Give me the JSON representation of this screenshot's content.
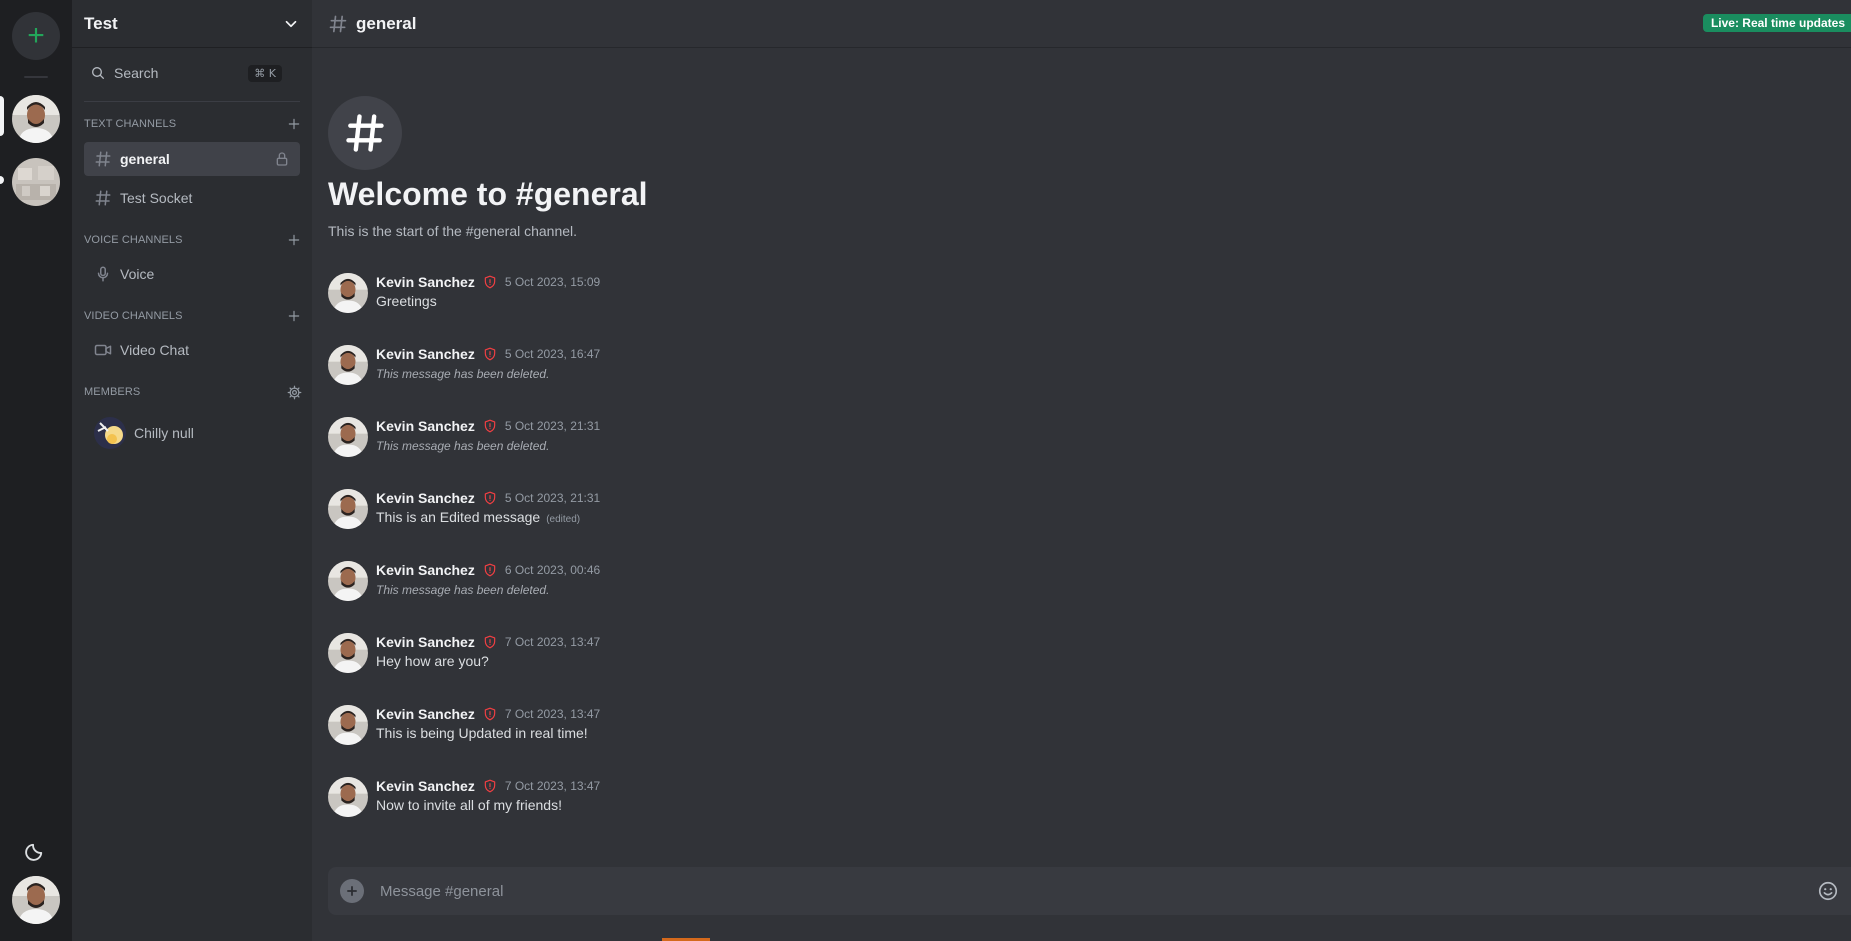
{
  "server_rail": {
    "add_symbol": "+"
  },
  "sidebar": {
    "server_name": "Test",
    "search_label": "Search",
    "search_shortcut": "⌘ K",
    "sections": {
      "text": "TEXT CHANNELS",
      "voice": "VOICE CHANNELS",
      "video": "VIDEO CHANNELS",
      "members": "MEMBERS"
    },
    "text_channels": [
      {
        "label": "general",
        "active": true,
        "locked": true
      },
      {
        "label": "Test Socket",
        "active": false
      }
    ],
    "voice_channels": [
      {
        "label": "Voice"
      }
    ],
    "video_channels": [
      {
        "label": "Video Chat"
      }
    ],
    "members": [
      {
        "label": "Chilly null"
      }
    ]
  },
  "header": {
    "channel_name": "general",
    "live_badge": "Live: Real time updates"
  },
  "welcome": {
    "title": "Welcome to #general",
    "subtitle": "This is the start of the #general channel."
  },
  "messages": [
    {
      "author": "Kevin Sanchez",
      "time": "5 Oct 2023, 15:09",
      "text": "Greetings",
      "deleted": false
    },
    {
      "author": "Kevin Sanchez",
      "time": "5 Oct 2023, 16:47",
      "text": "This message has been deleted.",
      "deleted": true
    },
    {
      "author": "Kevin Sanchez",
      "time": "5 Oct 2023, 21:31",
      "text": "This message has been deleted.",
      "deleted": true
    },
    {
      "author": "Kevin Sanchez",
      "time": "5 Oct 2023, 21:31",
      "text": "This is an Edited message",
      "deleted": false,
      "edited": "(edited)"
    },
    {
      "author": "Kevin Sanchez",
      "time": "6 Oct 2023, 00:46",
      "text": "This message has been deleted.",
      "deleted": true
    },
    {
      "author": "Kevin Sanchez",
      "time": "7 Oct 2023, 13:47",
      "text": "Hey how are you?",
      "deleted": false
    },
    {
      "author": "Kevin Sanchez",
      "time": "7 Oct 2023, 13:47",
      "text": "This is being Updated in real time!",
      "deleted": false
    },
    {
      "author": "Kevin Sanchez",
      "time": "7 Oct 2023, 13:47",
      "text": "Now to invite all of my friends!",
      "deleted": false
    }
  ],
  "composer": {
    "placeholder": "Message #general"
  },
  "colors": {
    "accent_green": "#23a55a",
    "live_badge": "#1a8d5f",
    "role_shield": "#f23f43",
    "background": "#313338"
  },
  "icons": {
    "shield": "shield-icon",
    "hash": "hash-icon",
    "lock": "lock-icon",
    "mic": "microphone-icon",
    "video": "video-camera-icon",
    "gear": "gear-icon",
    "moon": "moon-icon",
    "search": "search-icon",
    "chevron": "chevron-down-icon",
    "emoji": "emoji-icon"
  }
}
